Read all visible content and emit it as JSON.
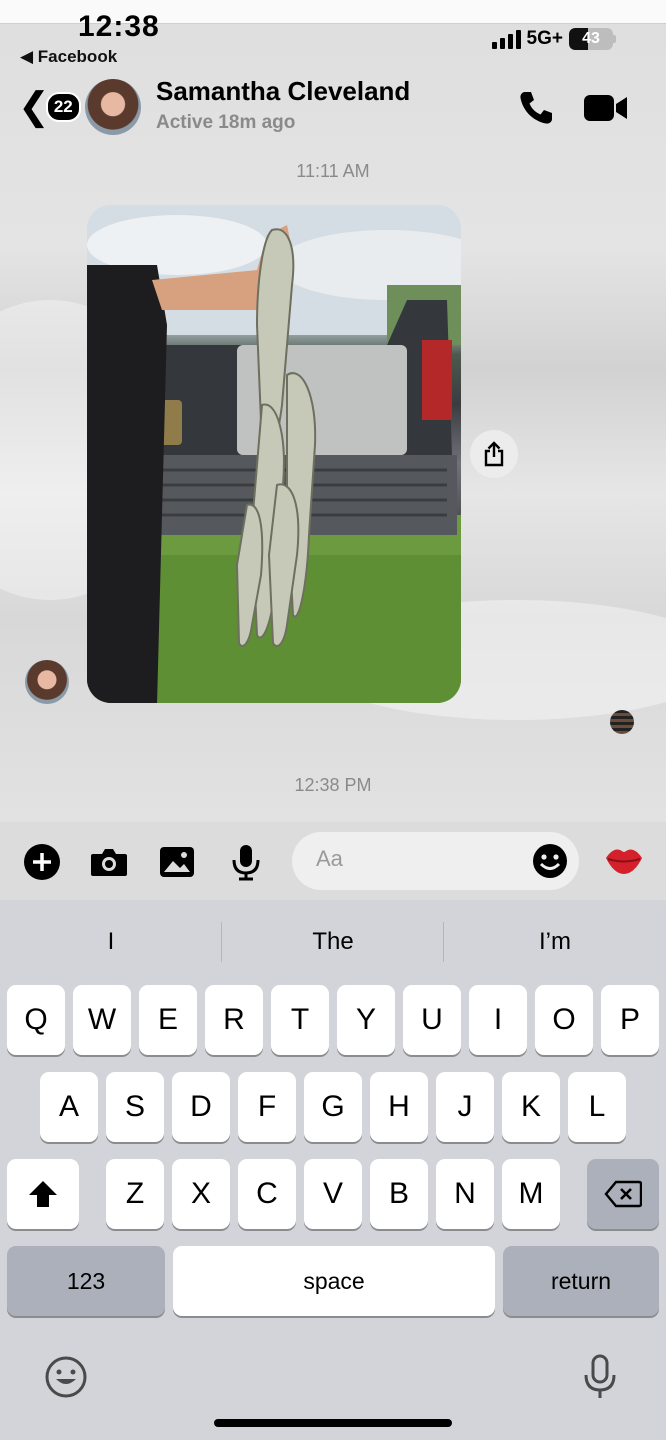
{
  "status_bar": {
    "time": "12:38",
    "back_app": "◀ Facebook",
    "network": "5G+",
    "battery": "43",
    "battery_level": 0.43
  },
  "header": {
    "unread_count": "22",
    "contact_name": "Samantha Cleveland",
    "contact_status": "Active 18m ago"
  },
  "messages": {
    "timestamp_1": "11:11 AM",
    "timestamp_2": "12:38 PM"
  },
  "composer": {
    "placeholder": "Aa"
  },
  "keyboard": {
    "suggestions": [
      "I",
      "The",
      "I’m"
    ],
    "row1": [
      "Q",
      "W",
      "E",
      "R",
      "T",
      "Y",
      "U",
      "I",
      "O",
      "P"
    ],
    "row2": [
      "A",
      "S",
      "D",
      "F",
      "G",
      "H",
      "J",
      "K",
      "L"
    ],
    "row3": [
      "Z",
      "X",
      "C",
      "V",
      "B",
      "N",
      "M"
    ],
    "numbers_label": "123",
    "space_label": "space",
    "return_label": "return"
  },
  "colors": {
    "chat_background": "#dedede",
    "keyboard_background": "#d2d4d9",
    "lips_red": "#d4202a"
  }
}
